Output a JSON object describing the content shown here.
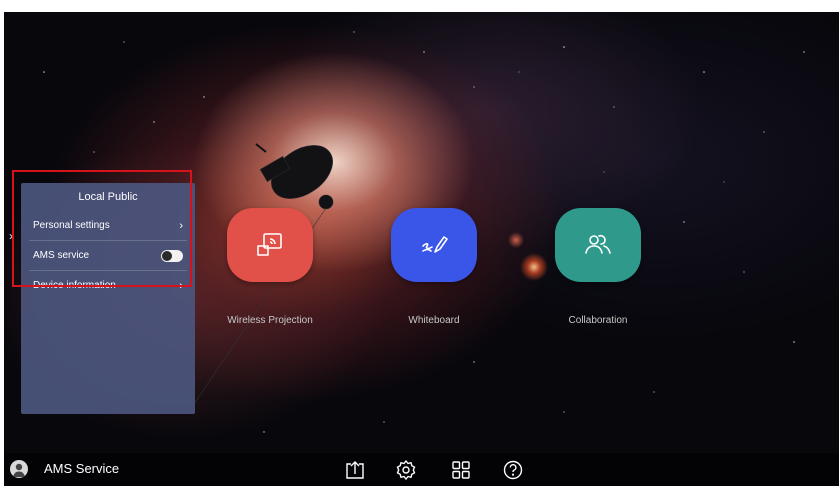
{
  "panel": {
    "title": "Local Public",
    "items": [
      {
        "label": "Personal settings",
        "control": "chevron"
      },
      {
        "label": "AMS service",
        "control": "toggle",
        "enabled": true
      },
      {
        "label": "Device information",
        "control": "chevron"
      }
    ],
    "chevron_glyph": "›",
    "highlight_color": "#d6121b"
  },
  "sidebar_toggle_glyph": "›",
  "apps": [
    {
      "label": "Wireless Projection",
      "icon": "cast-screen-icon",
      "color": "#e2504a"
    },
    {
      "label": "Whiteboard",
      "icon": "pen-scribble-icon",
      "color": "#3a56e8"
    },
    {
      "label": "Collaboration",
      "icon": "people-icon",
      "color": "#2f9a8c"
    }
  ],
  "taskbar": {
    "user_name": "AMS Service",
    "icons": [
      "upload-icon",
      "gear-icon",
      "apps-grid-icon",
      "help-icon"
    ]
  }
}
